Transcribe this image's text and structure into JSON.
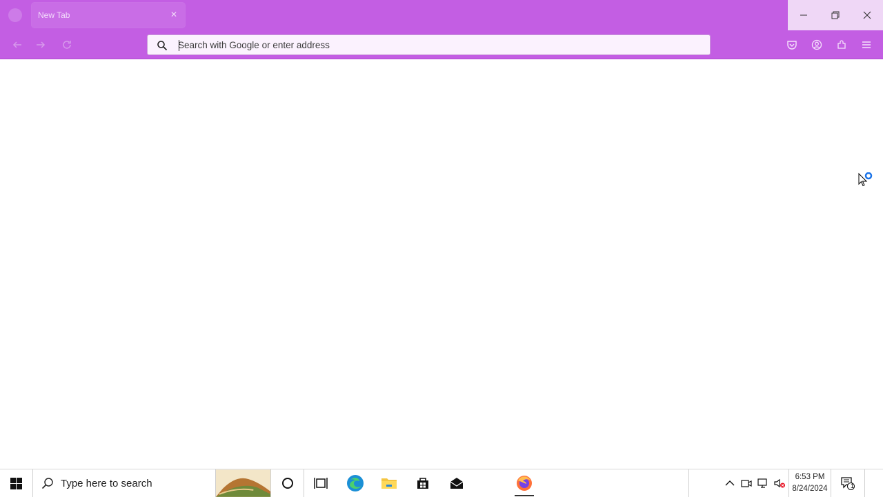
{
  "browser": {
    "tab": {
      "title": "New Tab"
    },
    "urlbar": {
      "placeholder": "Search with Google or enter address",
      "value": ""
    },
    "colors": {
      "chrome": "#c35ee3",
      "window_controls_bg": "#efd7f6"
    },
    "icons": [
      "back-icon",
      "forward-icon",
      "reload-icon",
      "search-icon",
      "pocket-icon",
      "account-icon",
      "extensions-icon",
      "menu-icon"
    ]
  },
  "taskbar": {
    "search_placeholder": "Type here to search",
    "apps": [
      "edge",
      "file-explorer",
      "microsoft-store",
      "mail",
      "firefox"
    ],
    "active_app": "firefox",
    "clock": {
      "time": "6:53 PM",
      "date": "8/24/2024"
    },
    "notification_count": "1"
  }
}
